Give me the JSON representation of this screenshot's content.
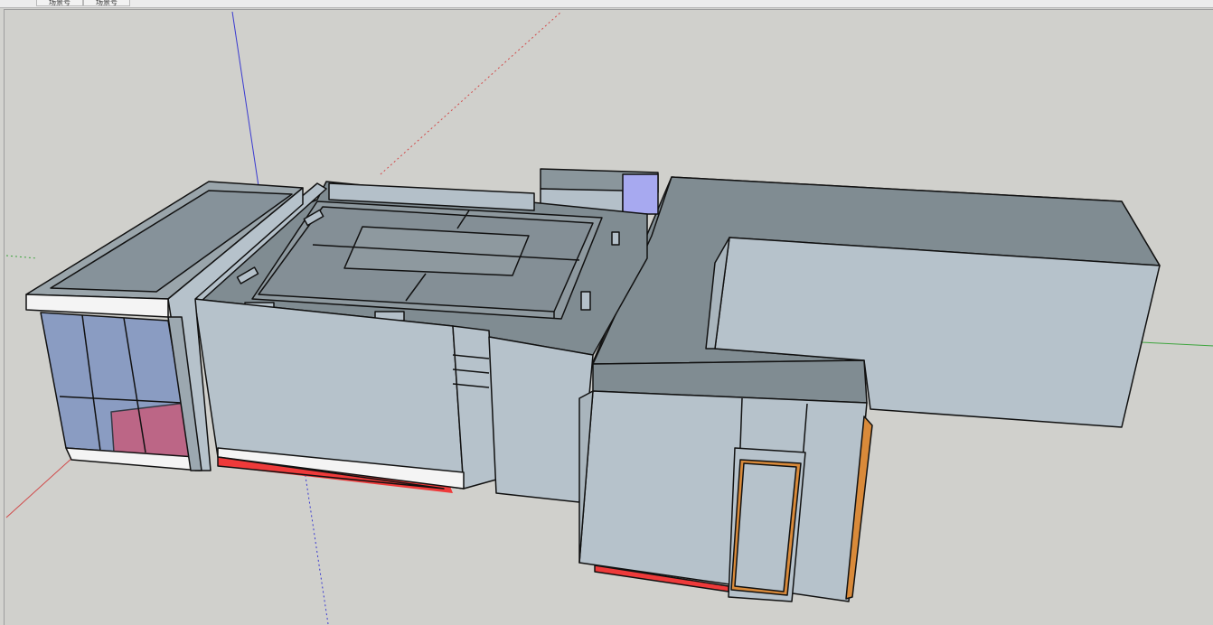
{
  "scene_tabs": [
    {
      "label": "场景号"
    },
    {
      "label": "场景号"
    }
  ],
  "colors": {
    "sky": "#d0d0cc",
    "wall": "#b7c3cc",
    "roof": "#7f8b91",
    "glass": "#8a9cc2",
    "highlight_red": "#ee3a3a",
    "highlight_orange": "#d98a3a",
    "axis_red": "#d14b4b",
    "axis_green": "#3ca43c",
    "axis_blue": "#3a3ad0"
  },
  "model": {
    "description_hidden": true
  }
}
